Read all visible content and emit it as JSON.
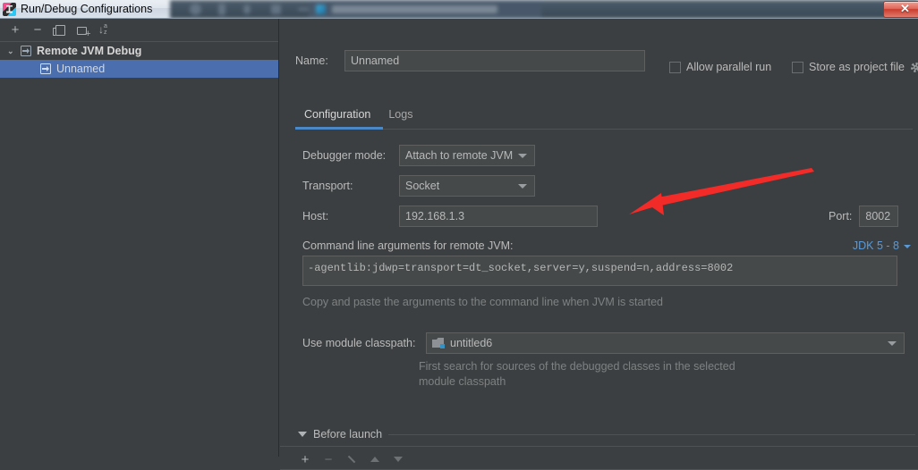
{
  "window": {
    "title": "Run/Debug Configurations",
    "app_icon": "intellij-idea-icon",
    "close_label": "✕"
  },
  "sidebar": {
    "toolbar": [
      {
        "name": "add-configuration-button",
        "icon": "plus-icon",
        "glyph": "+"
      },
      {
        "name": "remove-configuration-button",
        "icon": "minus-icon",
        "glyph": "−"
      },
      {
        "name": "copy-configuration-button",
        "icon": "copy-icon",
        "glyph": ""
      },
      {
        "name": "save-configuration-button",
        "icon": "folder-add-icon",
        "glyph": ""
      },
      {
        "name": "sort-configurations-button",
        "icon": "sort-alphabetically-icon",
        "glyph": ""
      }
    ],
    "tree": {
      "group": {
        "label": "Remote JVM Debug",
        "icon": "remote-jvm-debug-icon",
        "expanded": true,
        "twisty": "⌄"
      },
      "children": [
        {
          "label": "Unnamed",
          "icon": "remote-jvm-debug-icon",
          "selected": true
        }
      ]
    }
  },
  "panel": {
    "name_label": "Name:",
    "name_value": "Unnamed",
    "name_placeholder": "Unnamed",
    "allow_parallel_run": {
      "label": "Allow parallel run",
      "checked": false
    },
    "store_as_project_file": {
      "label": "Store as project file",
      "checked": false,
      "gear_icon": "gear-icon"
    },
    "tabs": [
      {
        "label": "Configuration",
        "active": true
      },
      {
        "label": "Logs",
        "active": false
      }
    ],
    "fields": {
      "debugger_mode_label": "Debugger mode:",
      "debugger_mode_value": "Attach to remote JVM",
      "transport_label": "Transport:",
      "transport_value": "Socket",
      "host_label": "Host:",
      "host_value": "192.168.1.3",
      "port_label": "Port:",
      "port_value": "8002"
    },
    "command_line": {
      "label": "Command line arguments for remote JVM:",
      "jdk_selector": "JDK 5 - 8",
      "value": "-agentlib:jdwp=transport=dt_socket,server=y,suspend=n,address=8002",
      "hint": "Copy and paste the arguments to the command line when JVM is started"
    },
    "classpath": {
      "label": "Use module classpath:",
      "value": "untitled6",
      "icon": "module-icon",
      "hint_line1": "First search for sources of the debugged classes in the selected",
      "hint_line2": "module classpath"
    },
    "before_launch": {
      "label": "Before launch",
      "expanded": true,
      "toolbar": [
        {
          "name": "before-launch-add-button",
          "icon": "plus-icon",
          "glyph": "+",
          "enabled": true
        },
        {
          "name": "before-launch-remove-button",
          "icon": "minus-icon",
          "glyph": "−",
          "enabled": false
        },
        {
          "name": "before-launch-edit-button",
          "icon": "pencil-icon",
          "glyph": "",
          "enabled": false
        },
        {
          "name": "before-launch-move-up-button",
          "icon": "arrow-up-icon",
          "glyph": "",
          "enabled": false
        },
        {
          "name": "before-launch-move-down-button",
          "icon": "arrow-down-icon",
          "glyph": "",
          "enabled": false
        }
      ]
    }
  },
  "annotation": {
    "arrow_color": "#f32b28",
    "points_to": "port-field"
  },
  "colors": {
    "background": "#3c3f41",
    "field_background": "#45494a",
    "selection": "#4b6eaf",
    "accent": "#4a88c7",
    "link": "#5b9ad6",
    "text": "#bbbbbb",
    "text_dim": "#7e8182",
    "annotation_red": "#f32b28"
  }
}
